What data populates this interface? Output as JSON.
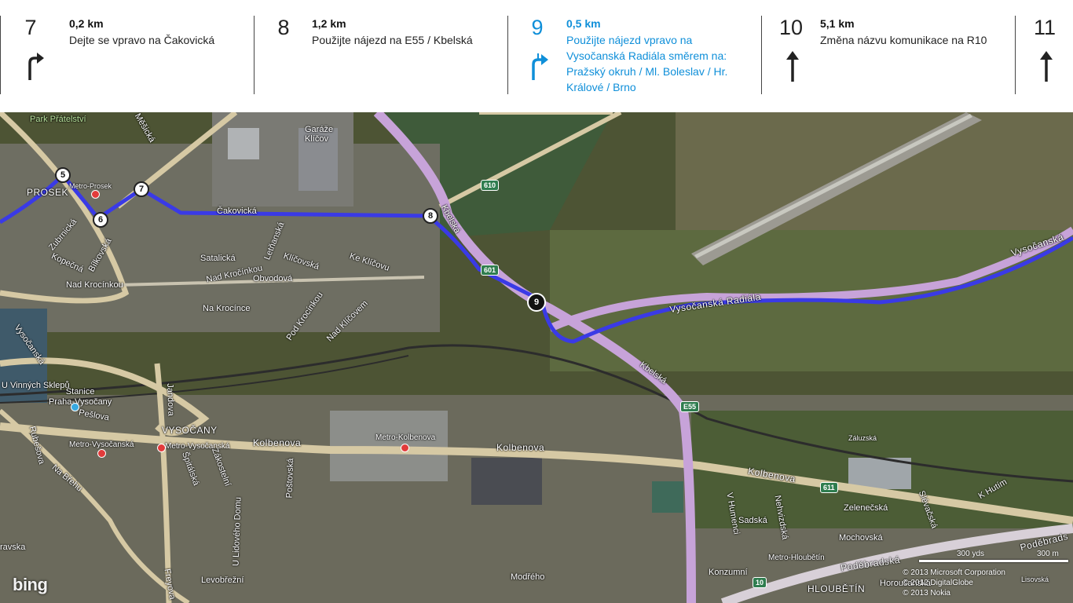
{
  "steps": [
    {
      "num": "7",
      "distance": "0,2 km",
      "instruction": "Dejte se vpravo na Čakovická",
      "arrow": "turn-right-icon"
    },
    {
      "num": "8",
      "distance": "1,2 km",
      "instruction": "Použijte nájezd na E55 / Kbelská",
      "arrow": ""
    },
    {
      "num": "9",
      "distance": "0,5 km",
      "instruction": "Použijte nájezd vpravo na Vysočanská Radiála směrem na: Pražský okruh / Ml. Boleslav / Hr. Králové / Brno",
      "arrow": "ramp-right-icon"
    },
    {
      "num": "10",
      "distance": "5,1 km",
      "instruction": "Změna názvu komunikace na R10",
      "arrow": "straight-icon"
    },
    {
      "num": "11",
      "distance": "",
      "instruction": "",
      "arrow": "straight-icon"
    }
  ],
  "map": {
    "labels": {
      "park": "Park Přátelství",
      "garaze": "Garáže\nKlíčov",
      "prosek": "PROSEK",
      "metro_prosek": "Metro-Prosek",
      "cakovicka": "Čakovická",
      "kbelska_n": "Kbelská",
      "kbelska_s": "Kbelská",
      "zubrnicka": "Zubrnická",
      "kopecna": "Kopečná",
      "nad_krocinkou1": "Nad Krocínkou",
      "nad_krocinkou2": "Nad Kročínkou",
      "satalicka": "Satalická",
      "obvodova": "Obvodová",
      "letnanska": "Letňanská",
      "klicovska": "Klíčovská",
      "ke_klicovu": "Ke Klíčovu",
      "na_krocince": "Na Krocínce",
      "pod_krocinkou": "Pod Krocínkou",
      "nad_klicovem": "Nad Klíčovem",
      "vysocanska_radiala": "Vysočanská Radiála",
      "vysocanska_radiala2": "Vysočanská",
      "vysocanska_w": "Vysočanská",
      "u_vinnych_sklepu": "U Vinných Sklepů",
      "stanice": "Stanice\nPraha-Vysočany",
      "peslova": "Pešlova",
      "vysocany": "VYSOČANY",
      "metro_vysocanska": "Metro-Vysočanská",
      "metro_vysocanska2": "Metro-Vysočanská",
      "kolbenova1": "Kolbenova",
      "kolbenova2": "Kolbenova",
      "kolbenova3": "Kolbenova",
      "metro_kolbenova": "Metro-Kolbenova",
      "postovska": "Poštovská",
      "freyova": "Freyova",
      "levobrezni": "Levobřežní",
      "modreho": "Modřého",
      "zaluzska": "Záluzská",
      "v_humenci": "V Humenci",
      "sadska": "Sadská",
      "nehvizdska": "Nehvizdská",
      "zelenecska": "Zelenečská",
      "mochovska": "Mochovská",
      "konzumni": "Konzumní",
      "metro_hloubetin": "Metro-Hloubětín",
      "podebradska1": "Poděbradská",
      "podebradska2": "Poděbrads",
      "hloubetin": "HLOUBĚTÍN",
      "horousanska": "Horoušanská",
      "k_hutim": "K Hutím",
      "rubesova": "Rubešova",
      "na_brehu": "Na Břehu",
      "spitalska": "Špitálská",
      "zakostelni": "Zákostelní",
      "u_lidoveho_domu": "U Lidového Domu",
      "jandova": "Jandova",
      "skorepka": "Bílkovská",
      "mesicka": "Měšická",
      "kravska": "ravska",
      "sievacka": "Slévačská",
      "lisovska": "Lisovská"
    },
    "shields": {
      "s610": "610",
      "s601": "601",
      "e55": "E55",
      "s611": "611",
      "s10": "10"
    },
    "waypoints": [
      "5",
      "6",
      "7",
      "8",
      "9"
    ],
    "scale": {
      "imperial": "300 yds",
      "metric": "300 m"
    },
    "copyright": [
      "© 2013 Microsoft Corporation",
      "© 2012 DigitalGlobe",
      "© 2013 Nokia"
    ],
    "brand": "bing"
  }
}
